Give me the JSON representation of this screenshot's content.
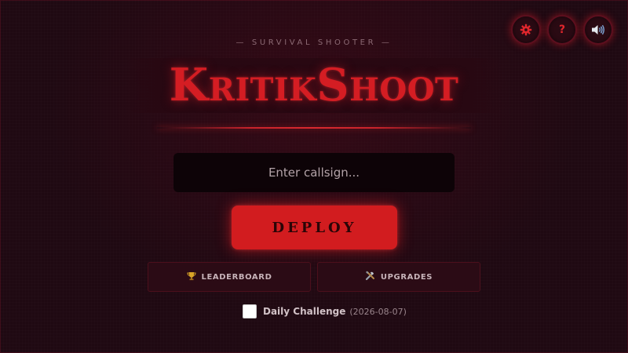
{
  "app": {
    "subtitle": "— SURVIVAL SHOOTER —",
    "title": "KritikShoot"
  },
  "top_buttons": {
    "settings_icon": "gear-icon",
    "help_label": "?",
    "sound_icon": "speaker-icon"
  },
  "callsign": {
    "placeholder": "Enter callsign...",
    "value": ""
  },
  "deploy": {
    "label": "DEPLOY"
  },
  "secondary": {
    "leaderboard": {
      "icon": "🏆",
      "label": "LEADERBOARD"
    },
    "upgrades": {
      "icon": "🛠",
      "label": "UPGRADES"
    }
  },
  "daily": {
    "label": "Daily Challenge",
    "date": "(2026-08-07)",
    "checked": false
  },
  "colors": {
    "accent": "#d21c1f",
    "background": "#1f0912",
    "title": "#d41d23"
  }
}
